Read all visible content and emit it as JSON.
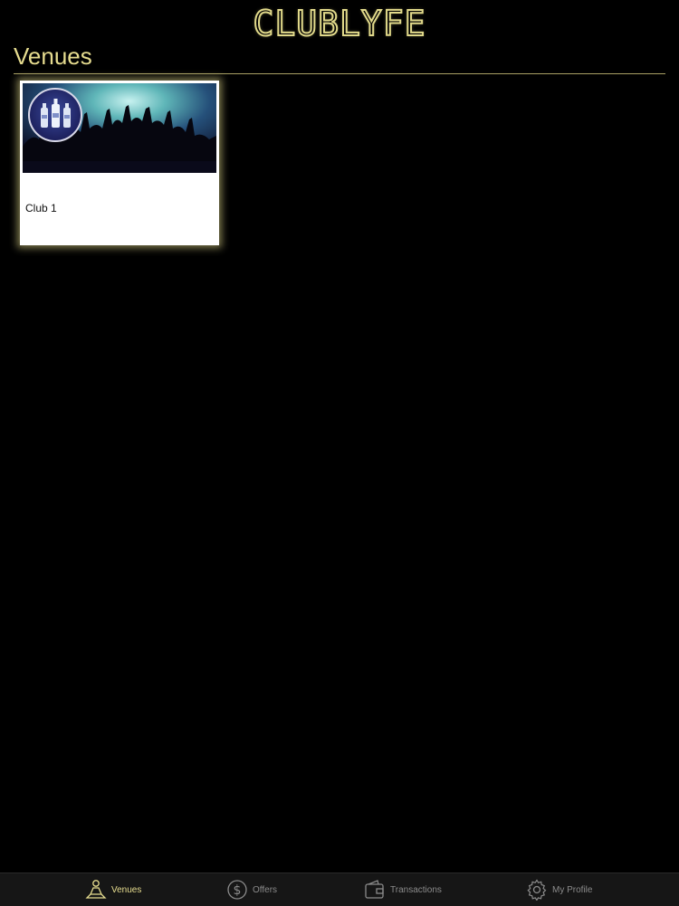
{
  "app": {
    "logo_text": "CLUBLYFE",
    "accent_color": "#e6dc8f",
    "background_color": "#000000"
  },
  "page": {
    "title": "Venues"
  },
  "venues": [
    {
      "name": "Club 1",
      "image": "concert-crowd-photo",
      "avatar": "vodka-bottles-logo"
    }
  ],
  "tabbar": {
    "items": [
      {
        "label": "Venues",
        "icon": "person-meditating-icon",
        "active": true
      },
      {
        "label": "Offers",
        "icon": "dollar-coin-icon",
        "active": false
      },
      {
        "label": "Transactions",
        "icon": "wallet-icon",
        "active": false
      },
      {
        "label": "My Profile",
        "icon": "gear-icon",
        "active": false
      }
    ]
  }
}
